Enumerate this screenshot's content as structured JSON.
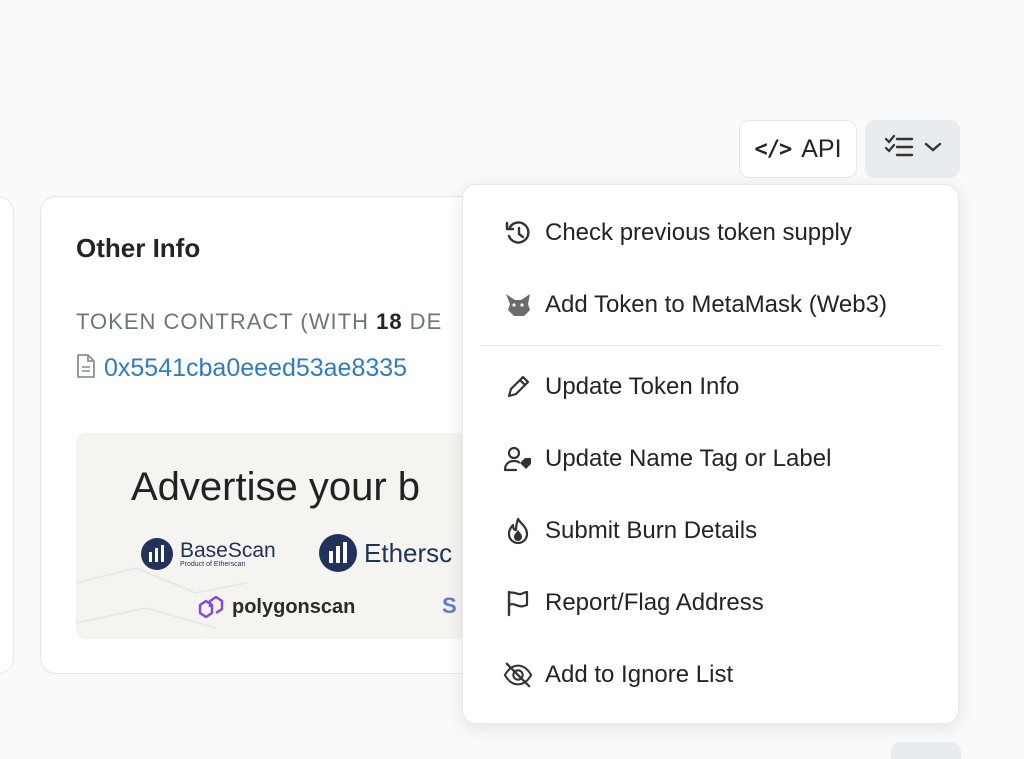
{
  "toolbar": {
    "api_label": "API",
    "api_icon": "code-icon",
    "menu_icon": "checklist-icon",
    "menu_chevron": "chevron-down-icon"
  },
  "info_card": {
    "title": "Other Info",
    "contract_label_prefix": "TOKEN CONTRACT (WITH ",
    "contract_decimals": "18",
    "contract_label_suffix": " DE",
    "contract_address": "0x5541cba0eeed53ae8335"
  },
  "ad": {
    "headline": "Advertise your b",
    "logos": [
      "BaseScan",
      "Ethersc",
      "polygonscan",
      "S"
    ],
    "basescan_sub": "Product of Etherscan"
  },
  "dropdown": {
    "items": [
      {
        "label": "Check previous token supply",
        "icon": "history-icon"
      },
      {
        "label": "Add Token to MetaMask (Web3)",
        "icon": "metamask-icon"
      },
      {
        "label": "Update Token Info",
        "icon": "pencil-icon"
      },
      {
        "label": "Update Name Tag or Label",
        "icon": "user-tag-icon"
      },
      {
        "label": "Submit Burn Details",
        "icon": "fire-icon"
      },
      {
        "label": "Report/Flag Address",
        "icon": "flag-icon"
      },
      {
        "label": "Add to Ignore List",
        "icon": "eye-slash-icon"
      }
    ]
  },
  "colors": {
    "link": "#2f7cc2",
    "muted": "#6c757d",
    "polygon": "#8247e5"
  }
}
